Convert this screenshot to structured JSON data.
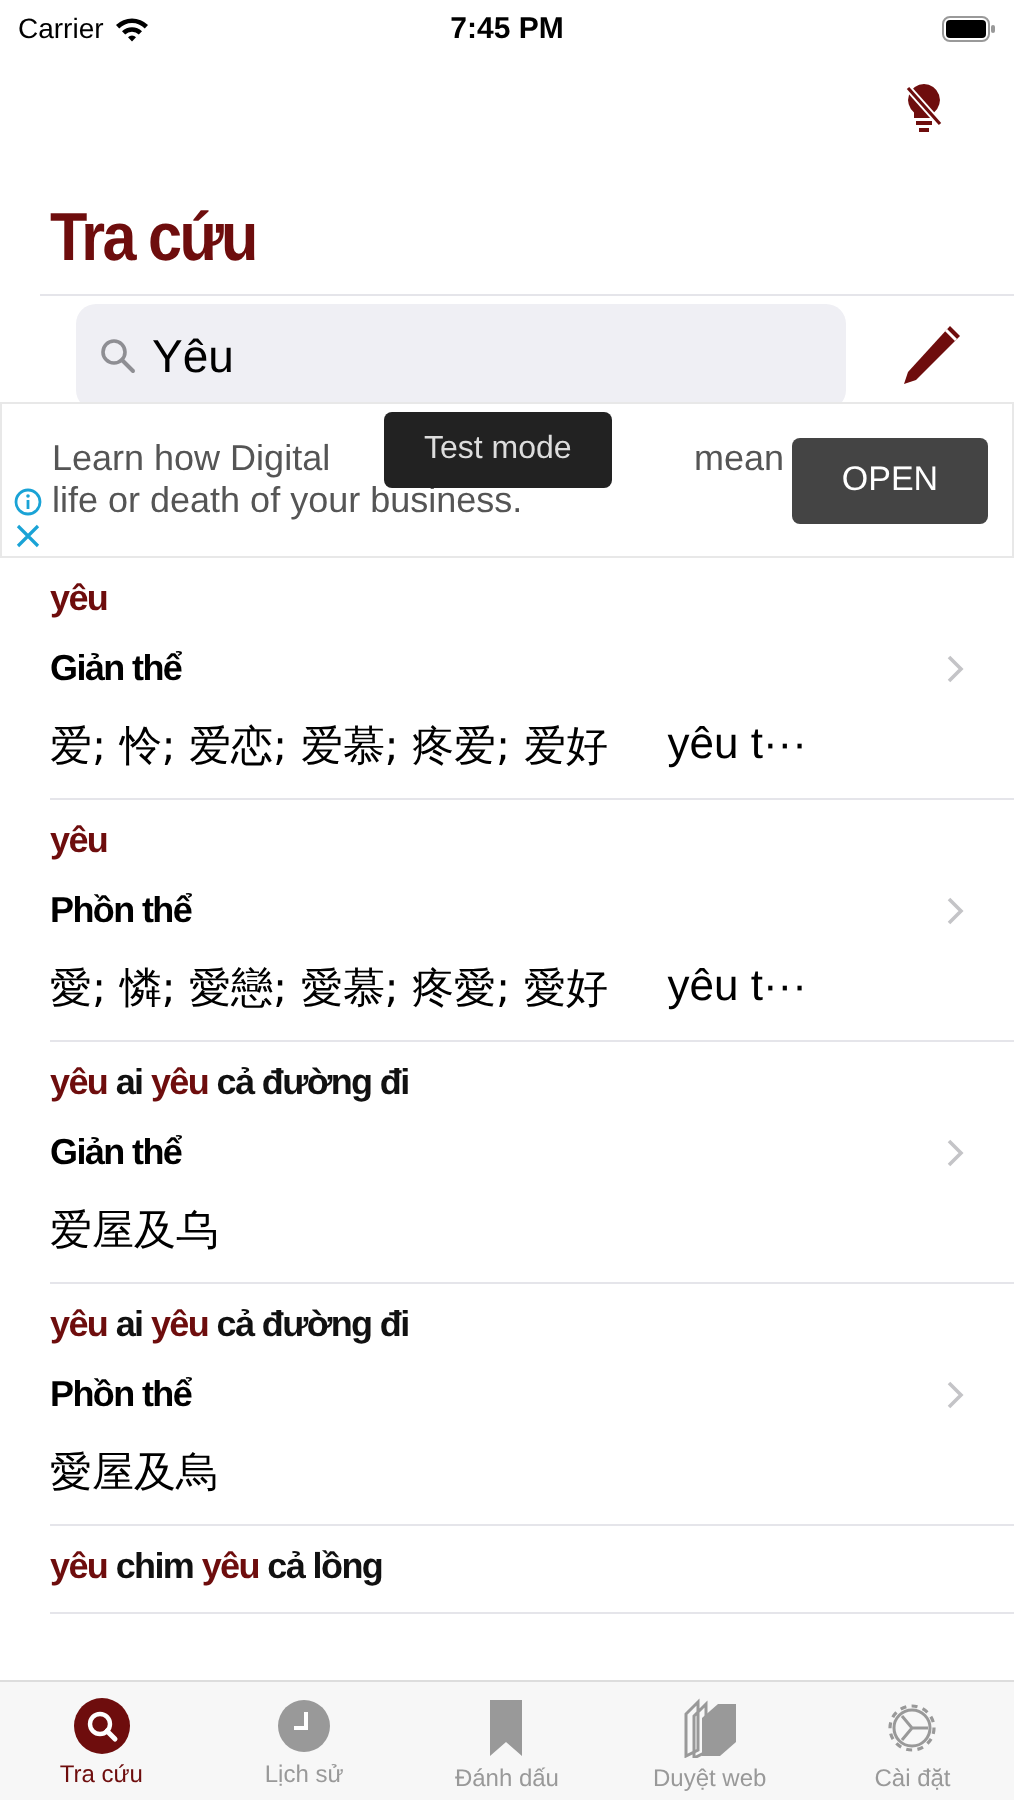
{
  "status_bar": {
    "carrier": "Carrier",
    "time": "7:45 PM"
  },
  "title": "Tra cứu",
  "search": {
    "value": "Yêu"
  },
  "ad": {
    "line_1_left": "Learn how Digital",
    "line_1_right": "mean",
    "line_2": "life or death of your business.",
    "button": "OPEN",
    "tooltip": "Test mode"
  },
  "results": [
    {
      "headword": [
        {
          "text": "yêu",
          "match": true
        }
      ],
      "script": "Giản thể",
      "chinese": "爱; 怜; 爱恋; 爱慕; 疼爱; 爱好",
      "extra": "yêu t···"
    },
    {
      "headword": [
        {
          "text": "yêu",
          "match": true
        }
      ],
      "script": "Phồn thể",
      "chinese": "愛; 憐; 愛戀; 愛慕; 疼愛; 愛好",
      "extra": "yêu t···"
    },
    {
      "headword": [
        {
          "text": "yêu",
          "match": true
        },
        {
          "text": "ai",
          "match": false
        },
        {
          "text": "yêu",
          "match": true
        },
        {
          "text": "cả đường đi",
          "match": false
        }
      ],
      "script": "Giản thể",
      "chinese": "爱屋及乌"
    },
    {
      "headword": [
        {
          "text": "yêu",
          "match": true
        },
        {
          "text": "ai",
          "match": false
        },
        {
          "text": "yêu",
          "match": true
        },
        {
          "text": "cả đường đi",
          "match": false
        }
      ],
      "script": "Phồn thể",
      "chinese": "愛屋及烏"
    },
    {
      "headword": [
        {
          "text": "yêu",
          "match": true
        },
        {
          "text": "chim",
          "match": false
        },
        {
          "text": "yêu",
          "match": true
        },
        {
          "text": "cả lồng",
          "match": false
        }
      ]
    }
  ],
  "tabs": [
    {
      "label": "Tra cứu",
      "kind": "search",
      "selected": true
    },
    {
      "label": "Lịch sử",
      "kind": "history",
      "selected": false
    },
    {
      "label": "Đánh dấu",
      "kind": "bookmark",
      "selected": false
    },
    {
      "label": "Duyệt web",
      "kind": "browse",
      "selected": false
    },
    {
      "label": "Cài đặt",
      "kind": "settings",
      "selected": false
    }
  ]
}
